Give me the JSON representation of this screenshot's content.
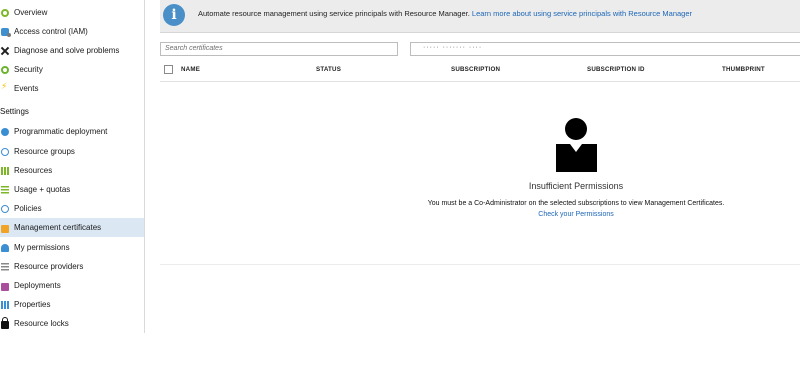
{
  "sidebar": {
    "section_settings": "Settings",
    "items": [
      {
        "label": "Overview",
        "icon": "overview-icon"
      },
      {
        "label": "Access control (IAM)",
        "icon": "access-control-icon"
      },
      {
        "label": "Diagnose and solve problems",
        "icon": "tools-icon"
      },
      {
        "label": "Security",
        "icon": "security-icon"
      },
      {
        "label": "Events",
        "icon": "lightning-icon"
      },
      {
        "label": "Programmatic deployment",
        "icon": "cloud-icon"
      },
      {
        "label": "Resource groups",
        "icon": "resource-groups-icon"
      },
      {
        "label": "Resources",
        "icon": "grid-icon"
      },
      {
        "label": "Usage + quotas",
        "icon": "usage-icon"
      },
      {
        "label": "Policies",
        "icon": "policies-icon"
      },
      {
        "label": "Management certificates",
        "icon": "certificate-icon"
      },
      {
        "label": "My permissions",
        "icon": "person-icon"
      },
      {
        "label": "Resource providers",
        "icon": "list-icon"
      },
      {
        "label": "Deployments",
        "icon": "deployments-icon"
      },
      {
        "label": "Properties",
        "icon": "properties-icon"
      },
      {
        "label": "Resource locks",
        "icon": "lock-icon"
      }
    ],
    "active_item": "Management certificates"
  },
  "banner": {
    "text": "Automate resource management using service principals with Resource Manager.",
    "link": "Learn more about using service principals with Resource Manager",
    "icon": "info-icon"
  },
  "search": {
    "placeholder": "Search certificates"
  },
  "subscription_select": {
    "value": "·····            ·······   ····"
  },
  "table": {
    "columns": [
      "NAME",
      "STATUS",
      "SUBSCRIPTION",
      "SUBSCRIPTION ID",
      "THUMBPRINT"
    ]
  },
  "empty_state": {
    "title": "Insufficient Permissions",
    "message": "You must be a Co-Administrator on the selected subscriptions to view Management Certificates.",
    "link": "Check your Permissions"
  },
  "colors": {
    "accent": "#1c66b7",
    "active_bg": "#dbe8f4",
    "banner_bg": "#ececec",
    "info": "#4a8fc8"
  }
}
